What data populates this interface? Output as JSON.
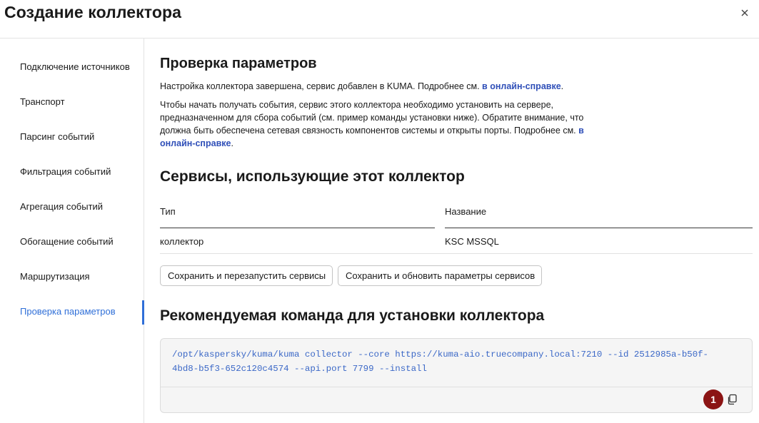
{
  "dialog": {
    "title": "Создание коллектора"
  },
  "sidebar": {
    "items": [
      {
        "label": "Подключение источников",
        "active": false
      },
      {
        "label": "Транспорт",
        "active": false
      },
      {
        "label": "Парсинг событий",
        "active": false
      },
      {
        "label": "Фильтрация событий",
        "active": false
      },
      {
        "label": "Агрегация событий",
        "active": false
      },
      {
        "label": "Обогащение событий",
        "active": false
      },
      {
        "label": "Маршрутизация",
        "active": false
      },
      {
        "label": "Проверка параметров",
        "active": true
      }
    ]
  },
  "main": {
    "verify_heading": "Проверка параметров",
    "p1_text": "Настройка коллектора завершена, сервис добавлен в KUMA. Подробнее см. ",
    "p1_link": "в онлайн-справке",
    "p1_end": ".",
    "p2_text": "Чтобы начать получать события, сервис этого коллектора необходимо установить на сервере, предназначенном для сбора событий (см. пример команды установки ниже). Обратите внимание, что должна быть обеспечена сетевая связность компонентов системы и открыты порты. Подробнее см. ",
    "p2_link": "в онлайн-справке",
    "p2_end": ".",
    "services_heading": "Сервисы, использующие этот коллектор",
    "table": {
      "headers": [
        "Тип",
        "Название"
      ],
      "rows": [
        [
          "коллектор",
          "KSC MSSQL"
        ]
      ]
    },
    "buttons": {
      "restart": "Сохранить и перезапустить сервисы",
      "update": "Сохранить и обновить параметры сервисов"
    },
    "command_heading": "Рекомендуемая команда для установки коллектора",
    "command_line1": "/opt/kaspersky/kuma/kuma collector --core https://kuma-aio.truecompany.local:7210 --id 2512985a-b50f-",
    "command_line2": "4bd8-b5f3-652c120c4574 --api.port 7799 --install",
    "badge": "1"
  },
  "colors": {
    "accent": "#2f6fd8",
    "link": "#2f4fb8",
    "code": "#3b68c7",
    "badge": "#8b1414"
  }
}
